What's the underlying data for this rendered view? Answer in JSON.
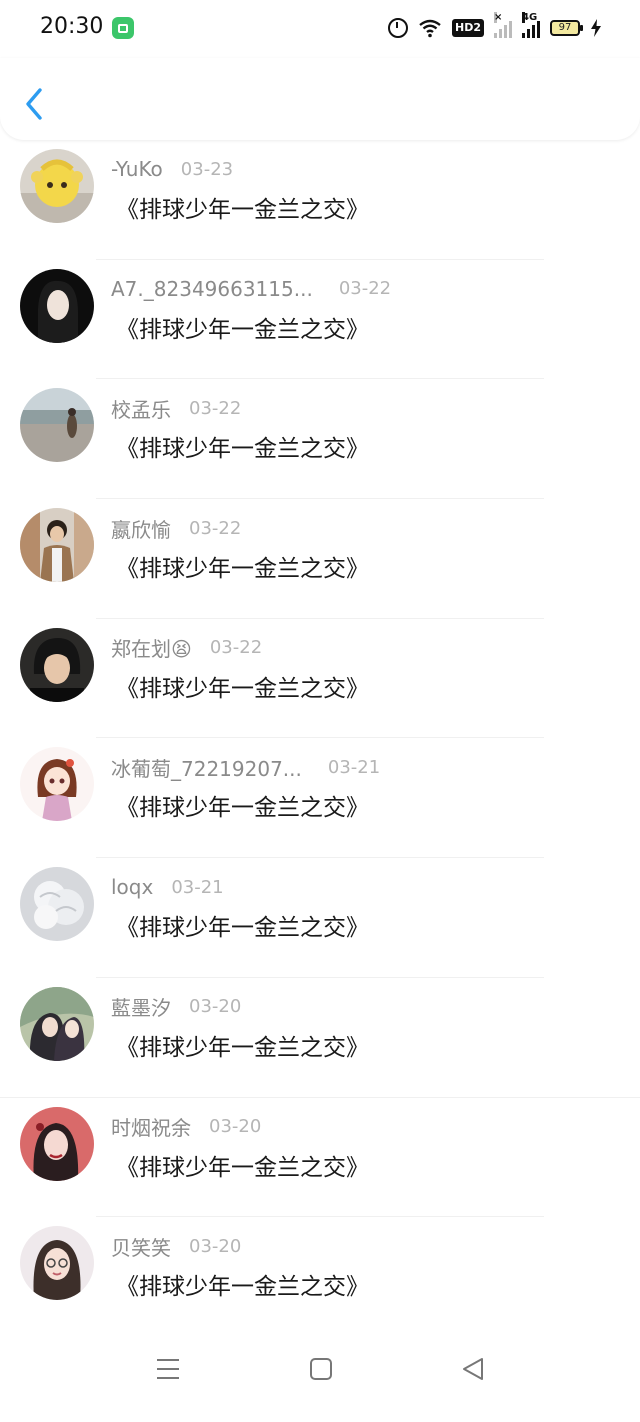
{
  "status_bar": {
    "time": "20:30",
    "hd_label": "HD2",
    "network_label": "4G",
    "battery_level": "97"
  },
  "comments": [
    {
      "user": "-YuKo",
      "date": "03-23",
      "text": "《排球少年一金兰之交》",
      "avatar": "yellow-bee-doll"
    },
    {
      "user": "A7._82349663115...",
      "date": "03-22",
      "text": "《排球少年一金兰之交》",
      "avatar": "dark-portrait"
    },
    {
      "user": "校孟乐",
      "date": "03-22",
      "text": "《排球少年一金兰之交》",
      "avatar": "beach-photo"
    },
    {
      "user": "嬴欣愉",
      "date": "03-22",
      "text": "《排球少年一金兰之交》",
      "avatar": "street-portrait"
    },
    {
      "user": "郑在划😫",
      "date": "03-22",
      "text": "《排球少年一金兰之交》",
      "avatar": "dark-selfie"
    },
    {
      "user": "冰葡萄_72219207...",
      "date": "03-21",
      "text": "《排球少年一金兰之交》",
      "avatar": "anime-girl"
    },
    {
      "user": "loqx",
      "date": "03-21",
      "text": "《排球少年一金兰之交》",
      "avatar": "white-flowers"
    },
    {
      "user": "藍墨汐",
      "date": "03-20",
      "text": "《排球少年一金兰之交》",
      "avatar": "illustrated-couple"
    },
    {
      "user": "时烟祝余",
      "date": "03-20",
      "text": "《排球少年一金兰之交》",
      "avatar": "red-illustration"
    },
    {
      "user": "贝笑笑",
      "date": "03-20",
      "text": "《排球少年一金兰之交》",
      "avatar": "girl-portrait"
    }
  ],
  "colors": {
    "accent": "#2d9cf0",
    "username": "#8a8a8a",
    "date": "#b5b5b5",
    "comment_text": "#1a1a1a"
  },
  "icons": {
    "back": "chevron-left-icon",
    "bottom_nav": [
      "menu-icon",
      "home-square-icon",
      "back-triangle-icon"
    ]
  }
}
